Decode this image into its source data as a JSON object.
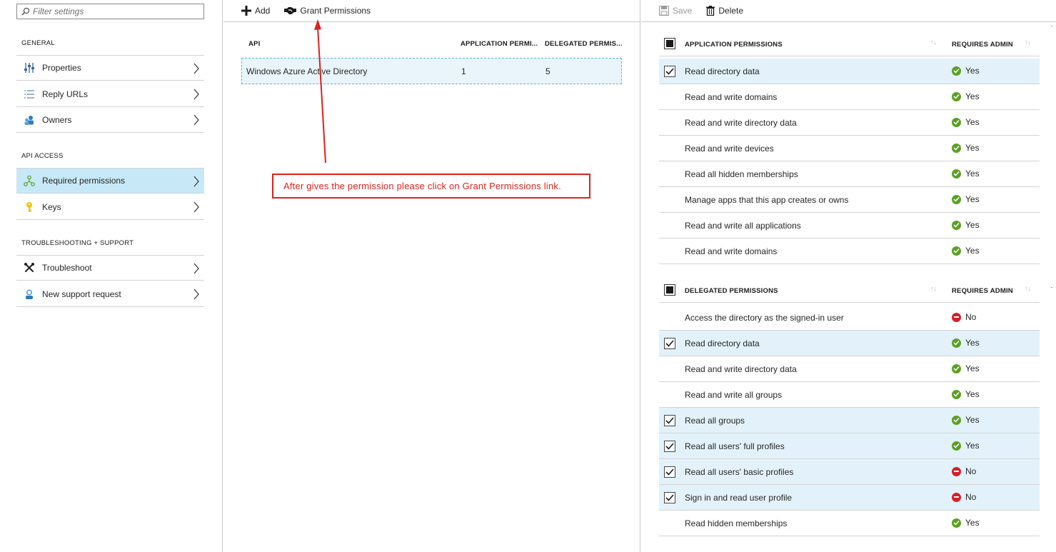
{
  "left": {
    "filter_placeholder": "Filter settings",
    "sections": {
      "general": "GENERAL",
      "api_access": "API ACCESS",
      "troubleshooting": "TROUBLESHOOTING + SUPPORT"
    },
    "items": [
      {
        "label": "Properties",
        "icon": "properties-icon"
      },
      {
        "label": "Reply URLs",
        "icon": "reply-urls-icon"
      },
      {
        "label": "Owners",
        "icon": "owners-icon"
      },
      {
        "label": "Required permissions",
        "icon": "required-permissions-icon",
        "selected": true
      },
      {
        "label": "Keys",
        "icon": "key-icon"
      },
      {
        "label": "Troubleshoot",
        "icon": "troubleshoot-icon"
      },
      {
        "label": "New support request",
        "icon": "support-request-icon"
      }
    ]
  },
  "middle": {
    "toolbar": {
      "add": "Add",
      "grant": "Grant Permissions"
    },
    "columns": {
      "api": "API",
      "app": "APPLICATION PERMI...",
      "delegated": "DELEGATED PERMIS..."
    },
    "rows": [
      {
        "api": "Windows Azure Active Directory",
        "app": "1",
        "delegated": "5"
      }
    ],
    "callout": "After gives the permission please click on Grant Permissions link."
  },
  "right": {
    "toolbar": {
      "save": "Save",
      "delete": "Delete"
    },
    "app_group": {
      "title": "APPLICATION PERMISSIONS",
      "admin": "REQUIRES ADMIN",
      "sort": "↑↓",
      "rows": [
        {
          "name": "Read directory data",
          "checked": true,
          "admin": "Yes"
        },
        {
          "name": "Read and write domains",
          "checked": false,
          "admin": "Yes"
        },
        {
          "name": "Read and write directory data",
          "checked": false,
          "admin": "Yes"
        },
        {
          "name": "Read and write devices",
          "checked": false,
          "admin": "Yes"
        },
        {
          "name": "Read all hidden memberships",
          "checked": false,
          "admin": "Yes"
        },
        {
          "name": "Manage apps that this app creates or owns",
          "checked": false,
          "admin": "Yes"
        },
        {
          "name": "Read and write all applications",
          "checked": false,
          "admin": "Yes"
        },
        {
          "name": "Read and write domains",
          "checked": false,
          "admin": "Yes"
        }
      ]
    },
    "delegated_group": {
      "title": "DELEGATED PERMISSIONS",
      "admin": "REQUIRES ADMIN",
      "sort": "↑↓",
      "rows": [
        {
          "name": "Access the directory as the signed-in user",
          "checked": false,
          "admin": "No"
        },
        {
          "name": "Read directory data",
          "checked": true,
          "admin": "Yes"
        },
        {
          "name": "Read and write directory data",
          "checked": false,
          "admin": "Yes"
        },
        {
          "name": "Read and write all groups",
          "checked": false,
          "admin": "Yes"
        },
        {
          "name": "Read all groups",
          "checked": true,
          "admin": "Yes"
        },
        {
          "name": "Read all users' full profiles",
          "checked": true,
          "admin": "Yes"
        },
        {
          "name": "Read all users' basic profiles",
          "checked": true,
          "admin": "No"
        },
        {
          "name": "Sign in and read user profile",
          "checked": true,
          "admin": "No"
        },
        {
          "name": "Read hidden memberships",
          "checked": false,
          "admin": "Yes"
        }
      ]
    }
  },
  "colors": {
    "selected": "#c7e8f7",
    "checked_row": "#e3f2fa",
    "yes": "#5aa121",
    "no": "#d4202a",
    "callout": "#e0211b"
  }
}
